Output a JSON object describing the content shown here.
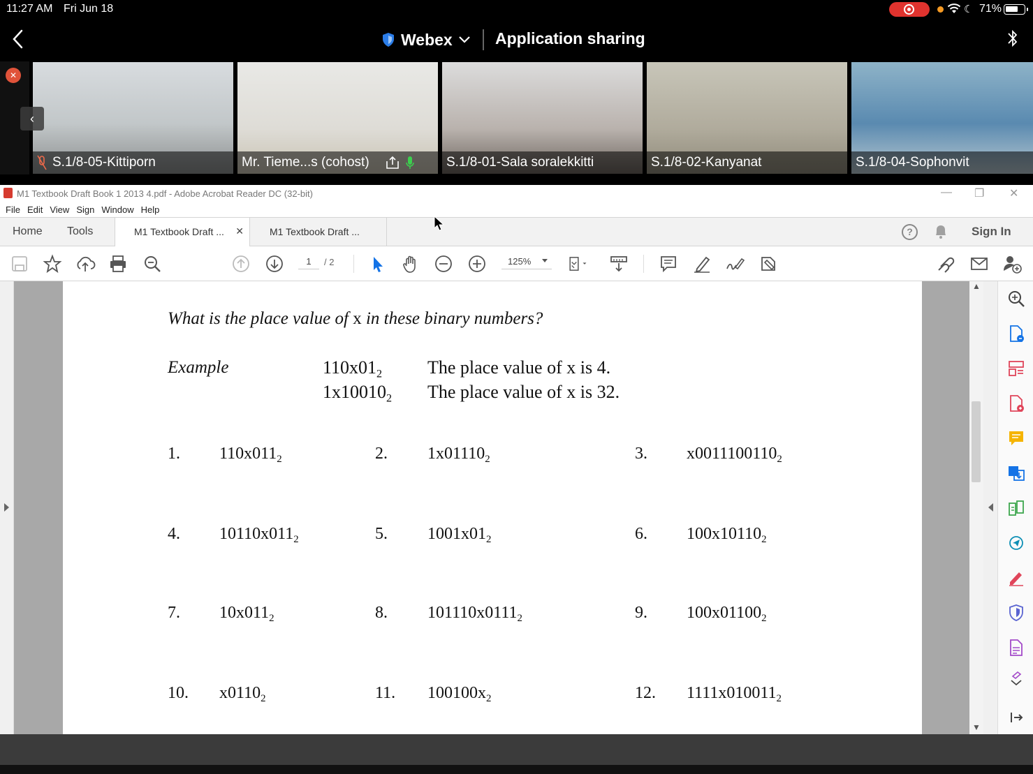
{
  "status_bar": {
    "time": "11:27 AM",
    "date": "Fri Jun 18",
    "battery": "71%",
    "battery_level": 0.71
  },
  "webex_header": {
    "app_name": "Webex",
    "mode": "Application sharing"
  },
  "participants": [
    {
      "name": "S.1/8-05-Kittiporn"
    },
    {
      "name": "Mr. Tieme...s (cohost)"
    },
    {
      "name": "S.1/8-01-Sala soralekkitti"
    },
    {
      "name": "S.1/8-02-Kanyanat"
    },
    {
      "name": "S.1/8-04-Sophonvit"
    }
  ],
  "acrobat": {
    "window_title": "M1 Textbook Draft Book 1 2013 4.pdf - Adobe Acrobat Reader DC (32-bit)",
    "menu": [
      "File",
      "Edit",
      "View",
      "Sign",
      "Window",
      "Help"
    ],
    "tabs": {
      "home": "Home",
      "tools": "Tools",
      "doc_active": "M1 Textbook Draft ...",
      "doc_inactive": "M1 Textbook Draft ..."
    },
    "sign_in": "Sign In",
    "page_current": "1",
    "page_total": "/ 2",
    "zoom": "125%"
  },
  "document": {
    "question": "What is the place value of",
    "question_x": "x",
    "question_end": "in these binary numbers?",
    "example_label": "Example",
    "examples": [
      {
        "num": "110x01",
        "base": "2",
        "text": "The place value of  x  is 4."
      },
      {
        "num": "1x10010",
        "base": "2",
        "text": "The place value of  x  is 32."
      }
    ],
    "items": [
      {
        "n": "1.",
        "v": "110x011",
        "b": "2"
      },
      {
        "n": "2.",
        "v": "1x01110",
        "b": "2"
      },
      {
        "n": "3.",
        "v": "x0011100110",
        "b": "2"
      },
      {
        "n": "4.",
        "v": "10110x011",
        "b": "2"
      },
      {
        "n": "5.",
        "v": "1001x01",
        "b": "2"
      },
      {
        "n": "6.",
        "v": "100x10110",
        "b": "2"
      },
      {
        "n": "7.",
        "v": "10x011",
        "b": "2"
      },
      {
        "n": "8.",
        "v": "101110x0111",
        "b": "2"
      },
      {
        "n": "9.",
        "v": "100x01100",
        "b": "2"
      },
      {
        "n": "10.",
        "v": "x0110",
        "b": "2"
      },
      {
        "n": "11.",
        "v": "100100x",
        "b": "2"
      },
      {
        "n": "12.",
        "v": "1111x010011",
        "b": "2"
      }
    ]
  },
  "colors": {
    "webex_accent": "#2b7de9",
    "recording": "#e0332e",
    "acrobat_blue": "#1473e6"
  }
}
